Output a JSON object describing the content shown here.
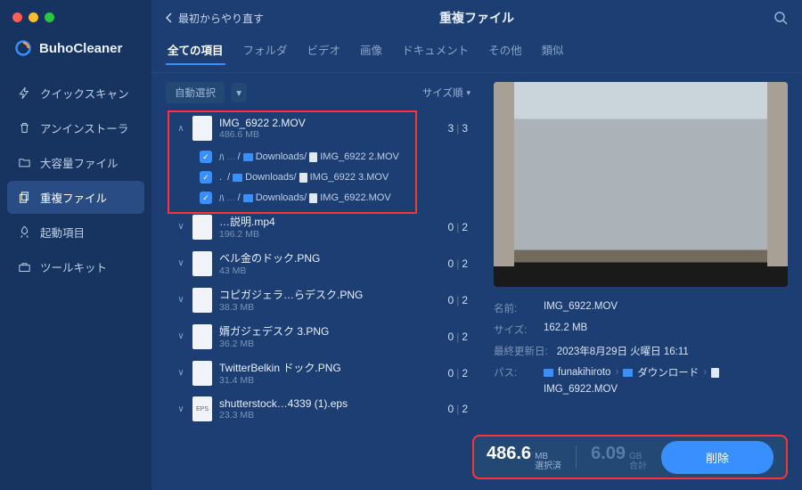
{
  "brand": "BuhoCleaner",
  "sidebar": {
    "items": [
      {
        "label": "クイックスキャン",
        "icon": "bolt"
      },
      {
        "label": "アンインストーラ",
        "icon": "trash"
      },
      {
        "label": "大容量ファイル",
        "icon": "folder"
      },
      {
        "label": "重複ファイル",
        "icon": "copy"
      },
      {
        "label": "起動項目",
        "icon": "rocket"
      },
      {
        "label": "ツールキット",
        "icon": "toolbox"
      }
    ]
  },
  "topbar": {
    "back": "最初からやり直す",
    "title": "重複ファイル"
  },
  "tabs": {
    "items": [
      "全ての項目",
      "フォルダ",
      "ビデオ",
      "画像",
      "ドキュメント",
      "その他",
      "類似"
    ]
  },
  "controls": {
    "auto_select": "自動選択",
    "sort": "サイズ順"
  },
  "groups": [
    {
      "name": "IMG_6922 2.MOV",
      "size": "486.6 MB",
      "selected": 3,
      "total": 3,
      "expanded": true,
      "files": [
        {
          "prefix": "ﾊ",
          "obscured": "...",
          "mid": "/",
          "folder": "Downloads/",
          "file": "IMG_6922 2.MOV"
        },
        {
          "prefix": ".",
          "obscured": "",
          "mid": "/",
          "folder": "Downloads/",
          "file": "IMG_6922 3.MOV"
        },
        {
          "prefix": "ﾊ",
          "obscured": "...",
          "mid": "/",
          "folder": "Downloads/",
          "file": "IMG_6922.MOV"
        }
      ]
    },
    {
      "name": "…説明.mp4",
      "size": "196.2 MB",
      "selected": 0,
      "total": 2,
      "expanded": false
    },
    {
      "name": "ベル金のドック.PNG",
      "size": "43 MB",
      "selected": 0,
      "total": 2,
      "expanded": false
    },
    {
      "name": "コピガジェラ…らデスク.PNG",
      "size": "38.3 MB",
      "selected": 0,
      "total": 2,
      "expanded": false
    },
    {
      "name": "婿ガジェデスク 3.PNG",
      "size": "36.2 MB",
      "selected": 0,
      "total": 2,
      "expanded": false
    },
    {
      "name": "TwitterBelkin ドック.PNG",
      "size": "31.4 MB",
      "selected": 0,
      "total": 2,
      "expanded": false
    },
    {
      "name": "shutterstock…4339 (1).eps",
      "size": "23.3 MB",
      "selected": 0,
      "total": 2,
      "expanded": false,
      "thumb": "EPS"
    }
  ],
  "preview": {
    "meta": {
      "name_label": "名前:",
      "name_value": "IMG_6922.MOV",
      "size_label": "サイズ:",
      "size_value": "162.2 MB",
      "date_label": "最終更新日:",
      "date_value": "2023年8月29日 火曜日 16:11",
      "path_label": "パス:",
      "path_parts": [
        "funakihiroto",
        "ダウンロード",
        "IMG_6922.MOV"
      ]
    }
  },
  "footer": {
    "selected_num": "486.6",
    "selected_unit": "MB",
    "selected_label": "選択済",
    "total_num": "6.09",
    "total_unit": "GB",
    "total_label": "合計",
    "delete": "削除"
  }
}
